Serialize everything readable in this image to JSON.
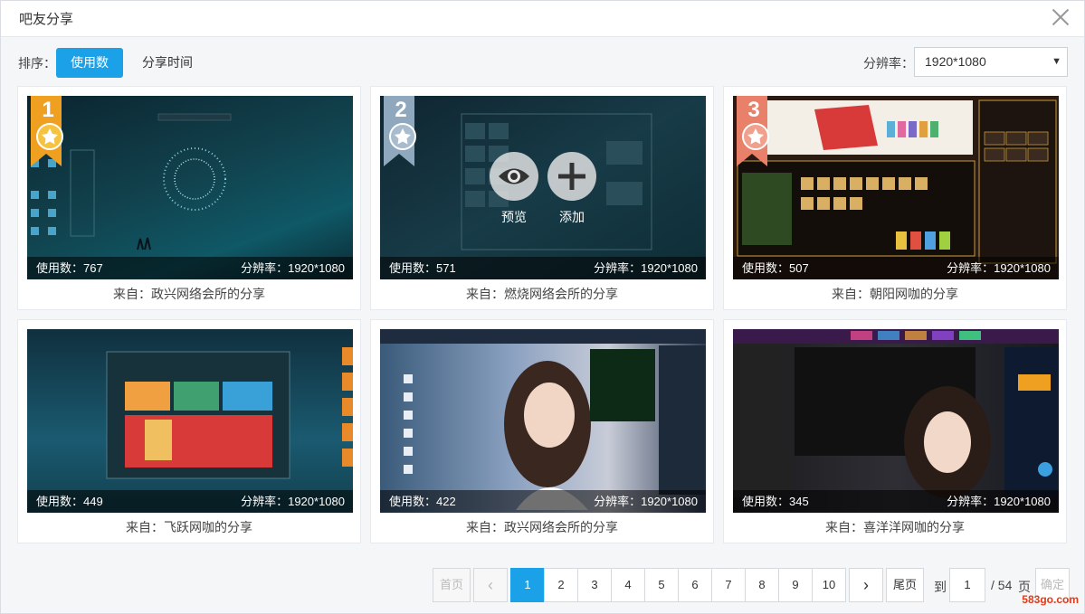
{
  "dialog": {
    "title": "吧友分享"
  },
  "toolbar": {
    "sort_label": "排序：",
    "sort_options": [
      "使用数",
      "分享时间"
    ],
    "resolution_label": "分辨率：",
    "resolution_value": "1920*1080"
  },
  "cards": [
    {
      "rank": "1",
      "uses": "使用数：767",
      "resolution": "分辨率：1920*1080",
      "from": "来自：政兴网络会所的分享"
    },
    {
      "rank": "2",
      "uses": "使用数：571",
      "resolution": "分辨率：1920*1080",
      "from": "来自：燃烧网络会所的分享",
      "overlay": {
        "preview": "预览",
        "add": "添加"
      }
    },
    {
      "rank": "3",
      "uses": "使用数：507",
      "resolution": "分辨率：1920*1080",
      "from": "来自：朝阳网咖的分享"
    },
    {
      "uses": "使用数：449",
      "resolution": "分辨率：1920*1080",
      "from": "来自：飞跃网咖的分享"
    },
    {
      "uses": "使用数：422",
      "resolution": "分辨率：1920*1080",
      "from": "来自：政兴网络会所的分享"
    },
    {
      "uses": "使用数：345",
      "resolution": "分辨率：1920*1080",
      "from": "来自：喜洋洋网咖的分享"
    }
  ],
  "pagination": {
    "first": "首页",
    "prev": "‹",
    "pages": [
      "1",
      "2",
      "3",
      "4",
      "5",
      "6",
      "7",
      "8",
      "9",
      "10"
    ],
    "current": "1",
    "next": "›",
    "last": "尾页",
    "goto_label": "到",
    "goto_value": "1",
    "total": "/ 54",
    "page_unit": "页",
    "confirm": "确定"
  },
  "watermark": "583go.com",
  "colors": {
    "accent": "#1ba1e8",
    "gold": "#f0a020",
    "silver": "#8fa8bd",
    "bronze": "#e8806a"
  }
}
